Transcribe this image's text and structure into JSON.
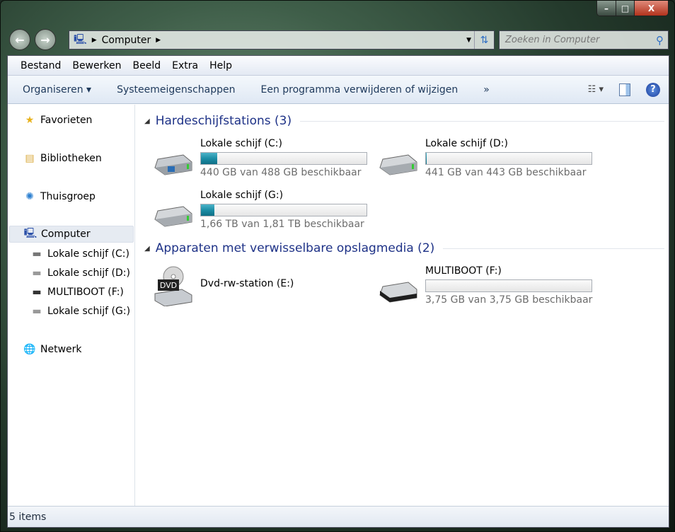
{
  "window": {
    "minimize": "–",
    "maximize": "□",
    "close": "X"
  },
  "address": {
    "crumb": "Computer",
    "search_placeholder": "Zoeken in Computer"
  },
  "menu": [
    "Bestand",
    "Bewerken",
    "Beeld",
    "Extra",
    "Help"
  ],
  "commands": {
    "organize": "Organiseren ▾",
    "system": "Systeemeigenschappen",
    "uninstall": "Een programma verwijderen of wijzigen",
    "more": "»",
    "help": "?"
  },
  "nav": {
    "favorites": "Favorieten",
    "libraries": "Bibliotheken",
    "homegroup": "Thuisgroep",
    "computer": "Computer",
    "drives": [
      "Lokale schijf (C:)",
      "Lokale schijf (D:)",
      "MULTIBOOT (F:)",
      "Lokale schijf (G:)"
    ],
    "network": "Netwerk"
  },
  "groups": {
    "hdd": "Hardeschijfstations (3)",
    "removable": "Apparaten met verwisselbare opslagmedia (2)"
  },
  "drives": [
    {
      "name": "Lokale schijf (C:)",
      "info": "440 GB van 488 GB beschikbaar",
      "used_fraction": 0.098
    },
    {
      "name": "Lokale schijf (D:)",
      "info": "441 GB van 443 GB beschikbaar",
      "used_fraction": 0.005
    },
    {
      "name": "Lokale schijf (G:)",
      "info": "1,66 TB van 1,81 TB beschikbaar",
      "used_fraction": 0.083
    },
    {
      "name": "Dvd-rw-station (E:)",
      "label": "DVD"
    },
    {
      "name": "MULTIBOOT (F:)",
      "info": "3,75 GB van 3,75 GB beschikbaar",
      "used_fraction": 0.0
    }
  ],
  "status": "5 items"
}
